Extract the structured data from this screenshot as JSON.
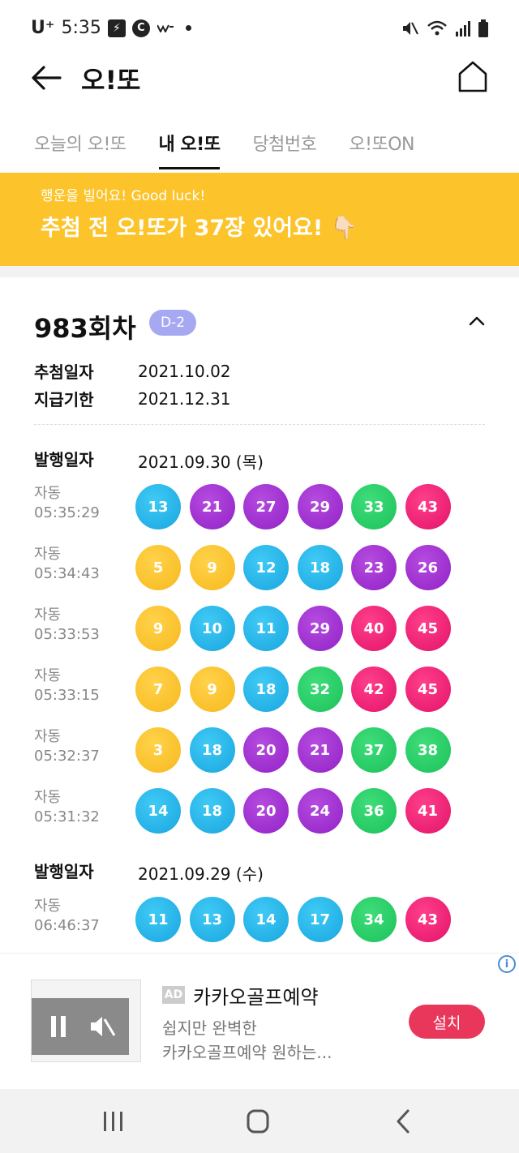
{
  "status_bar": {
    "carrier": "U⁺",
    "time": "5:35"
  },
  "header": {
    "title": "오!또"
  },
  "tabs": [
    {
      "label": "오늘의 오!또",
      "active": false
    },
    {
      "label": "내 오!또",
      "active": true
    },
    {
      "label": "당첨번호",
      "active": false
    },
    {
      "label": "오!또ON",
      "active": false
    }
  ],
  "banner": {
    "sub": "행운을 빌어요! Good luck!",
    "main": "추첨 전 오!또가 37장 있어요! 👇🏻",
    "color": "#fcc42a"
  },
  "round": {
    "title": "983회차",
    "badge": "D-2",
    "draw_label": "추첨일자",
    "draw_date": "2021.10.02",
    "deadline_label": "지급기한",
    "deadline_date": "2021.12.31"
  },
  "groups": [
    {
      "label": "발행일자",
      "date": "2021.09.30 (목)",
      "tickets": [
        {
          "kind": "자동",
          "time": "05:35:29",
          "numbers": [
            13,
            21,
            27,
            29,
            33,
            43
          ]
        },
        {
          "kind": "자동",
          "time": "05:34:43",
          "numbers": [
            5,
            9,
            12,
            18,
            23,
            26
          ]
        },
        {
          "kind": "자동",
          "time": "05:33:53",
          "numbers": [
            9,
            10,
            11,
            29,
            40,
            45
          ]
        },
        {
          "kind": "자동",
          "time": "05:33:15",
          "numbers": [
            7,
            9,
            18,
            32,
            42,
            45
          ]
        },
        {
          "kind": "자동",
          "time": "05:32:37",
          "numbers": [
            3,
            18,
            20,
            21,
            37,
            38
          ]
        },
        {
          "kind": "자동",
          "time": "05:31:32",
          "numbers": [
            14,
            18,
            20,
            24,
            36,
            41
          ]
        }
      ]
    },
    {
      "label": "발행일자",
      "date": "2021.09.29 (수)",
      "tickets": [
        {
          "kind": "자동",
          "time": "06:46:37",
          "numbers": [
            11,
            13,
            14,
            17,
            34,
            43
          ]
        }
      ]
    }
  ],
  "ball_colors": {
    "1-9": "#f7b91e",
    "10-18": "#1aa6e0",
    "19-29": "#9222c6",
    "30-39": "#1cc25a",
    "40-45": "#e3136a"
  },
  "ad": {
    "tag": "AD",
    "title": "카카오골프예약",
    "desc1": "쉽지만 완벽한",
    "desc2": "카카오골프예약 원하는...",
    "install": "설치",
    "info_icon": "i"
  }
}
